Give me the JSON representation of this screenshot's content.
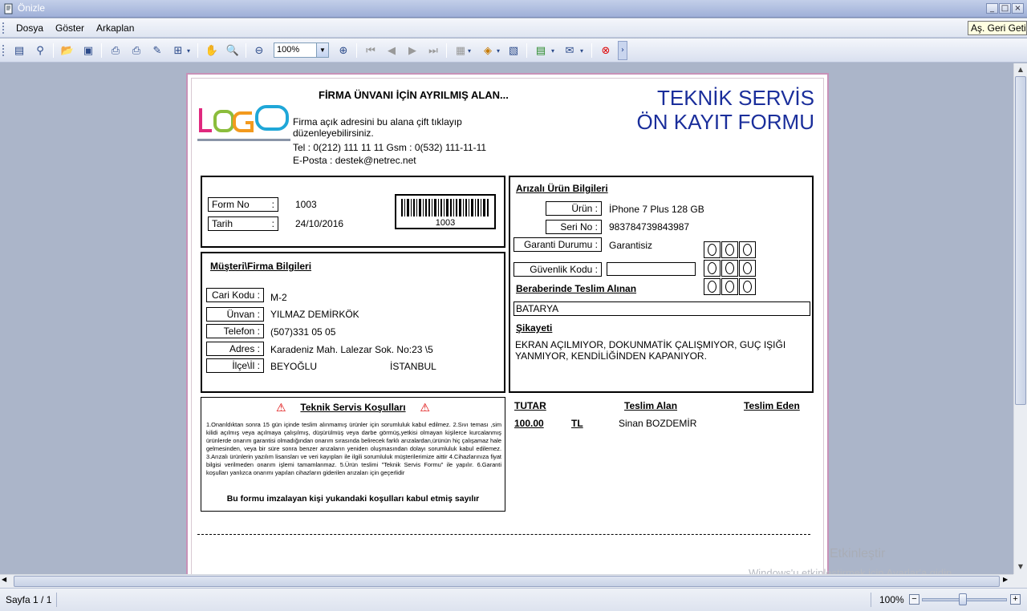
{
  "window": {
    "title": "Önizle",
    "min": "_",
    "max": "□",
    "close": "×"
  },
  "menu": {
    "items": [
      "Dosya",
      "Göster",
      "Arkaplan"
    ]
  },
  "tooltip": "Aş. Geri Getir",
  "toolbar": {
    "zoom": "100%"
  },
  "status": {
    "page": "Sayfa 1 / 1",
    "zoom": "100%"
  },
  "watermark": {
    "line1": "Etkinleştir",
    "line2": "Windows'u etkinleştirmek için Ayarlar'a gidin."
  },
  "form": {
    "firm_title": "FİRMA ÜNVANI İÇİN AYRILMIŞ ALAN...",
    "address_1": "Firma açık adresini bu alana çift tıklayıp",
    "address_2": "düzenleyebilirsiniz.",
    "phone": "Tel : 0(212)  111 11 11  Gsm : 0(532) 111-11-11",
    "email": "E-Posta : destek@netrec.net",
    "heading_1": "TEKNİK SERVİS",
    "heading_2": "ÖN  KAYIT   FORMU",
    "form_no_label": "Form No",
    "form_no": "1003",
    "date_label": "Tarih",
    "date": "24/10/2016",
    "colon": ":",
    "barcode_text": "1003",
    "customer_title": "Müşteri\\Firma Bilgileri",
    "cari_label": "Cari Kodu :",
    "cari": "M-2",
    "unvan_label": "Ünvan :",
    "unvan": "YILMAZ DEMİRKÖK",
    "telefon_label": "Telefon :",
    "telefon": "(507)331 05 05",
    "adres_label": "Adres :",
    "adres": "Karadeniz Mah. Lalezar Sok. No:23 \\5",
    "ilce_label": "İlçe\\İl :",
    "ilce": "BEYOĞLU",
    "il": "İSTANBUL",
    "product_title": "Arızalı Ürün Bilgileri",
    "urun_label": "Ürün :",
    "urun": "İPhone 7 Plus 128 GB",
    "seri_label": "Seri No :",
    "seri": "983784739843987",
    "garanti_label": "Garanti Durumu :",
    "garanti": "Garantisiz",
    "guvenlik_label": "Güvenlik Kodu :",
    "beraber_title": "Beraberinde Teslim Alınan",
    "beraber": "BATARYA",
    "sikayet_title": "Şikayeti",
    "sikayet": "EKRAN AÇILMIYOR, DOKUNMATİK ÇALIŞMIYOR, GUÇ IŞIĞI YANMIYOR, KENDİLİĞİNDEN KAPANIYOR.",
    "terms_title": "Teknik Servis Koşulları",
    "terms_text": "1.Onarıldıktan sonra 15 gün içinde teslim alınmamış ürünler için sorumluluk kabul edilmez. 2.Sıvı teması ,sim kilidi açılmış veya açılmaya çalışılmış, düşürülmüş veya darbe görmüş,yetkisi olmayan kişilerce kurcalanmış ürünlerde onarım garantisi olmadığından onarım sırasında belirecek farklı arızalardan,ürünün hiç çalışamaz hale gelmesinden, veya bir süre sonra benzer arızaların yeniden oluşmasından dolayı sorumluluk kabul edilemez. 3.Arızalı ürünlerin yazılım lisansları ve veri kayıpları ile ilgili sorumluluk müşterilerimize aittir 4.Cihazlarınıza fiyat bilgisi verilmeden onarım işlemi tamamlanmaz. 5.Ürün teslimi \"Teknik Servis Formu\" ile yapılır. 6.Garanti koşulları yanlızca onarımı yapılan cihazların giderilen arızaları için geçerlidir",
    "terms_footer": "Bu formu imzalayan kişi yukandaki koşulları kabul etmiş sayılır",
    "tutar_label": "TUTAR",
    "tutar": "100.00",
    "currency": "TL",
    "teslim_alan_label": "Teslim Alan",
    "teslim_alan": "Sinan BOZDEMİR",
    "teslim_eden_label": "Teslim Eden"
  }
}
